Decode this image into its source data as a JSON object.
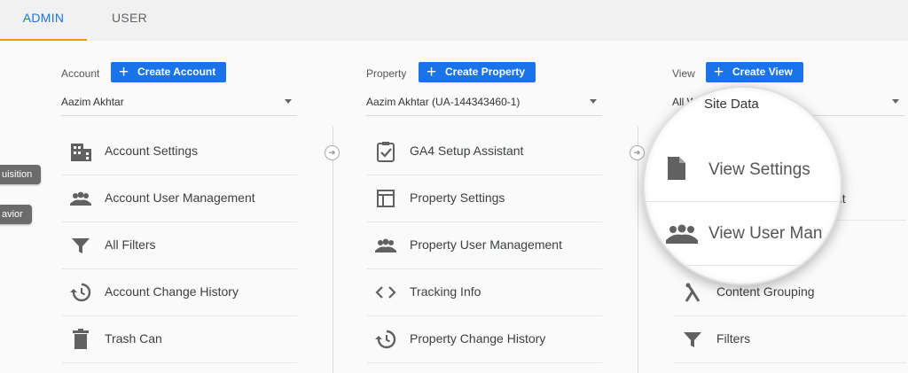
{
  "tabs": [
    "ADMIN",
    "USER"
  ],
  "side_pills": [
    "uisition",
    "avior"
  ],
  "account": {
    "label": "Account",
    "button": "Create Account",
    "selected": "Aazim Akhtar",
    "items": [
      "Account Settings",
      "Account User Management",
      "All Filters",
      "Account Change History",
      "Trash Can"
    ]
  },
  "property": {
    "label": "Property",
    "button": "Create Property",
    "selected": "Aazim Akhtar (UA-144343460-1)",
    "items": [
      "GA4 Setup Assistant",
      "Property Settings",
      "Property User Management",
      "Tracking Info",
      "Property Change History"
    ]
  },
  "view": {
    "label": "View",
    "button": "Create View",
    "selected_left": "All W",
    "selected_right": "Site Data",
    "partial_item": "nt",
    "items": [
      "Content Grouping",
      "Filters"
    ],
    "magnified": [
      "View Settings",
      "View User Man"
    ]
  },
  "colors": {
    "accent": "#1a73e8",
    "tab_underline": "#f29900",
    "icon": "#616161"
  }
}
